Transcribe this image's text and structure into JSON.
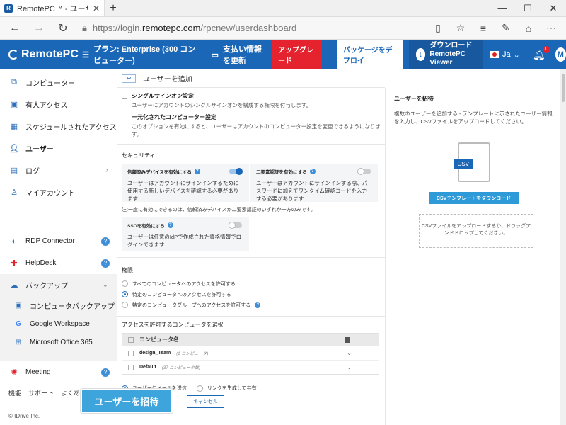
{
  "browser": {
    "tab_title": "RemotePC™ - ユーザー管理",
    "url_prefix": "https://login.",
    "url_domain": "remotepc.com",
    "url_path": "/rpcnew/userdashboard"
  },
  "header": {
    "logo": "RemotePC",
    "plan": "プラン: Enterprise (300 コンピューター)",
    "billing": "支払い情報を更新",
    "upgrade": "アップグレード",
    "deploy": "パッケージをデプロイ",
    "download_line1": "ダウンロード",
    "download_line2": "RemotePC Viewer",
    "lang": "Ja",
    "notif_count": "1",
    "avatar_initial": "M"
  },
  "sidebar": {
    "items": [
      {
        "label": "コンピューター"
      },
      {
        "label": "有人アクセス"
      },
      {
        "label": "スケジュールされたアクセス"
      },
      {
        "label": "ユーザー"
      },
      {
        "label": "ログ"
      },
      {
        "label": "マイアカウント"
      },
      {
        "label": "RDP Connector"
      },
      {
        "label": "HelpDesk"
      },
      {
        "label": "バックアップ"
      },
      {
        "label": "Meeting"
      }
    ],
    "backup_sub": [
      {
        "label": "コンピュータバックアップ"
      },
      {
        "label": "Google Workspace"
      },
      {
        "label": "Microsoft Office 365"
      }
    ],
    "footer": [
      "機能",
      "サポート",
      "よくあ"
    ],
    "copyright": "© IDrive Inc."
  },
  "main": {
    "title": "ユーザーを追加",
    "sso_title": "シングルサインオン設定",
    "sso_desc": "ユーザーにアカウントのシングルサインオンを構成する権限を付与します。",
    "unified_title": "一元化されたコンピューター設定",
    "unified_desc": "このオプションを有効にすると、ユーザーはアカウントのコンピューター設定を変更できるようになります。",
    "security_title": "セキュリティ",
    "trusted_title": "信頼済みデバイスを有効にする",
    "trusted_desc": "ユーザーはアカウントにサインインするために使用する新しいデバイスを確認する必要があります",
    "twofa_title": "二要素認証を有効にする",
    "twofa_desc": "ユーザーはアカウントにサインインする際、パスワードに加えてワンタイム確認コードを入力する必要があります",
    "note": "注:一度に有効にできるのは、信頼済みデバイスか二要素認証のいずれか一方のみです。",
    "ssocard_title": "SSOを有効にする",
    "ssocard_desc": "ユーザーは任意のIdPで作成された資格情報でログインできます",
    "perm_title": "権限",
    "perm_options": [
      "すべてのコンピュータへのアクセスを許可する",
      "特定のコンピュータへのアクセスを許可する",
      "特定のコンピュータグループへのアクセスを許可する"
    ],
    "select_title": "アクセスを許可するコンピュータを選択",
    "col_name": "コンピュータ名",
    "groups": [
      {
        "name": "design_Team",
        "count": "(1 コンピュータ)"
      },
      {
        "name": "Default",
        "count": "(37 コンピュータ数)"
      }
    ],
    "send_email": "ユーザーにメールを送信",
    "share_link": "リンクを生成して共有",
    "cancel": "キャンセル",
    "invite": "ユーザーを招待"
  },
  "right": {
    "title": "ユーザーを招待",
    "desc": "複数のユーザーを追加する - テンプレートに示されたユーザー情報を入力し、CSVファイルをアップロードしてください。",
    "csv_tag": "CSV",
    "download_btn": "CSVテンプレートをダウンロード",
    "drop_text": "CSVファイルをアップロードするか、ドラッグアンドドロップしてください。"
  }
}
